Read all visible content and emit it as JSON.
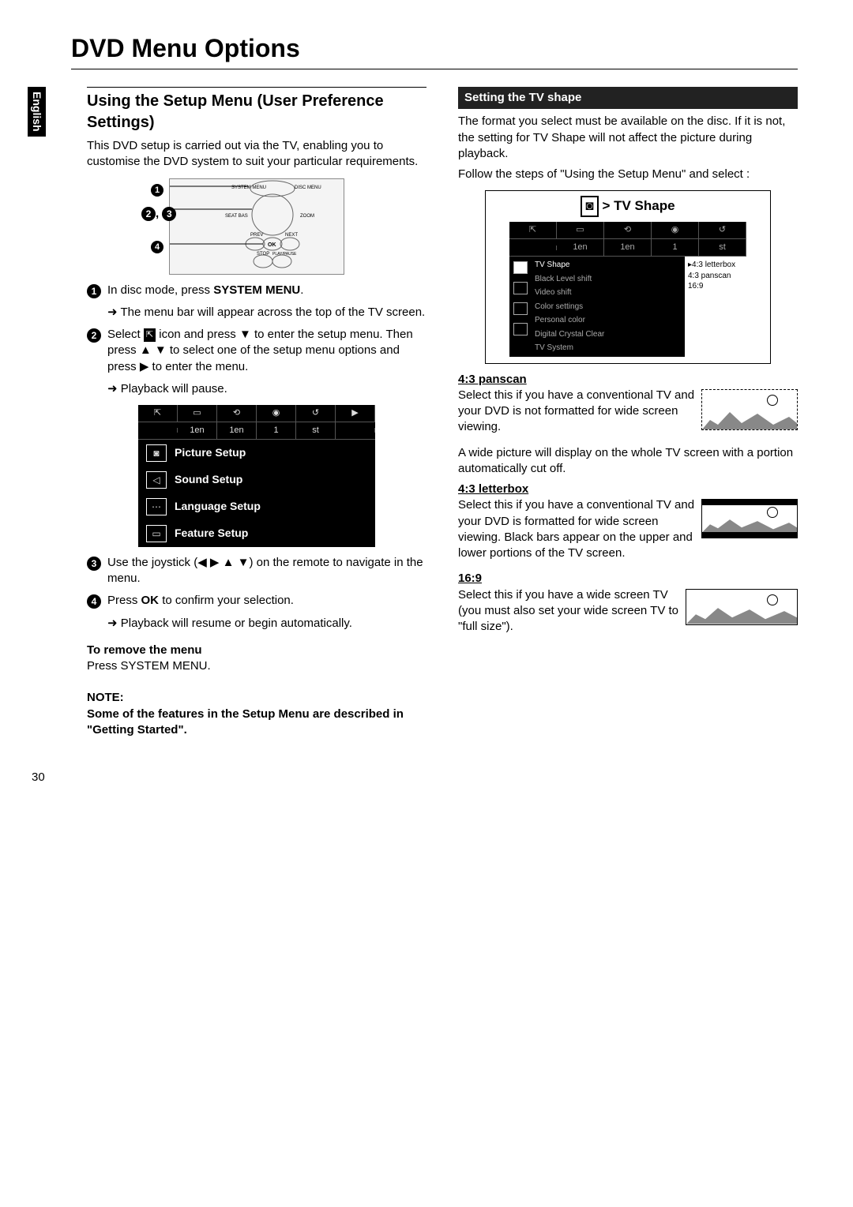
{
  "page": {
    "title": "DVD Menu Options",
    "tab": "English",
    "number": "30"
  },
  "left": {
    "heading": "Using the Setup Menu (User Preference Settings)",
    "intro": "This DVD setup is carried out via the TV, enabling you to customise the DVD system to suit your particular requirements.",
    "remote": {
      "labels": {
        "systemMenu": "SYSTEM MENU",
        "discMenu": "DISC MENU",
        "seatbas": "SEAT BAS",
        "zoom": "ZOOM",
        "prev": "PREV",
        "next": "NEXT",
        "ok": "OK",
        "stop": "STOP",
        "playpause": "PLAY/PAUSE"
      },
      "callouts": [
        "1",
        "2, 3",
        "4"
      ]
    },
    "steps": {
      "s1a": "In disc mode, press ",
      "s1b": "SYSTEM MENU",
      "s1c": ".",
      "s1sub": "The menu bar will appear across the top of the TV screen.",
      "s2a": "Select ",
      "s2b": " icon and press ▼ to enter the setup menu.  Then press ▲ ▼ to select one of the setup menu options and press ▶ to enter the menu.",
      "s2sub": "Playback will pause.",
      "s3": "Use the joystick (◀ ▶ ▲ ▼) on the remote to navigate in the menu.",
      "s4a": "Press ",
      "s4b": "OK",
      "s4c": " to confirm your selection.",
      "s4sub": "Playback will resume or begin automatically."
    },
    "menubox": {
      "row1": [
        "⇱",
        "▭",
        "⟲",
        "◉",
        "↺"
      ],
      "row2": [
        "",
        "1en",
        "1en",
        "1",
        "st"
      ],
      "items": [
        "Picture Setup",
        "Sound Setup",
        "Language Setup",
        "Feature Setup"
      ],
      "icons": [
        "◙",
        "◁",
        "⋯",
        "▭"
      ]
    },
    "remove": {
      "h": "To remove the menu",
      "t": "Press SYSTEM MENU."
    },
    "note": {
      "h": "NOTE:",
      "t": "Some of the features in the Setup Menu are described in \"Getting Started\"."
    }
  },
  "right": {
    "bar": "Setting the TV shape",
    "p1": "The format you select must be available on the disc.  If it is not, the setting for TV Shape will not affect the picture during playback.",
    "p2": "Follow the steps of \"Using the Setup Menu\" and select :",
    "tvshape": {
      "title": "> TV Shape",
      "row1": [
        "⇱",
        "▭",
        "⟲",
        "◉",
        "↺"
      ],
      "row2": [
        "",
        "1en",
        "1en",
        "1",
        "st"
      ],
      "list": [
        "TV Shape",
        "Black Level shift",
        "Video shift",
        "Color settings",
        "Personal color",
        "Digital Crystal Clear",
        "TV System"
      ],
      "options": [
        "4:3 letterbox",
        "4:3 panscan",
        "16:9"
      ]
    },
    "opts": {
      "panscan": {
        "h": "4:3 panscan",
        "t1": "Select this if you have a conventional TV and your DVD is not formatted for wide screen viewing.",
        "t2": "A wide picture will display on the whole TV screen with a portion automatically cut off."
      },
      "letterbox": {
        "h": "4:3 letterbox",
        "t": "Select this if you have a conventional TV and your DVD is formatted for wide screen viewing.  Black bars appear on the upper and lower portions of the TV screen."
      },
      "wide": {
        "h": "16:9",
        "t": "Select this if you have a wide screen TV (you must also set your wide screen TV to \"full size\")."
      }
    }
  }
}
